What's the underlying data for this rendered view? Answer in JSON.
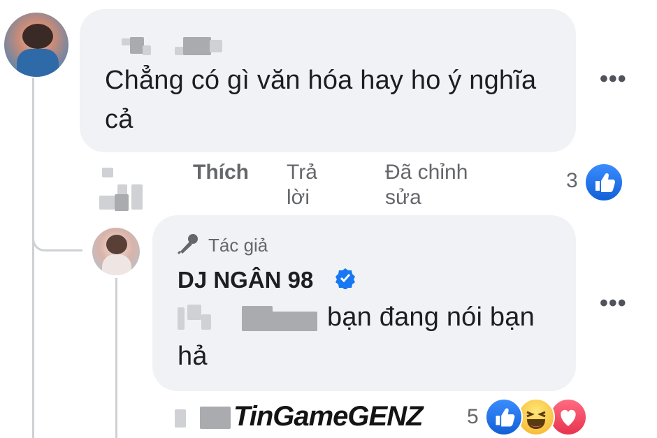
{
  "colors": {
    "bubble": "#f0f2f5",
    "secondary_text": "#65676b",
    "like_blue": "#1877f2",
    "verified_blue": "#1877f2",
    "love_red": "#f33e58",
    "haha_yellow": "#f7b125"
  },
  "comment": {
    "text": "Chẳng có gì văn hóa hay ho ý nghĩa cả",
    "actions": {
      "like": "Thích",
      "reply": "Trả lời",
      "edited": "Đã chỉnh sửa"
    },
    "reaction_count": "3",
    "reactions": [
      "like-icon"
    ]
  },
  "reply": {
    "author_badge": "Tác giả",
    "author_name": "DJ NGÂN 98",
    "verified": true,
    "text_visible": "bạn đang nói bạn hả",
    "reaction_count": "5",
    "reactions": [
      "like-icon",
      "haha-icon",
      "love-icon"
    ]
  },
  "watermark": {
    "text": "TinGameGENZ"
  },
  "icons": {
    "more": "more-options-icon",
    "author": "microphone-icon",
    "verified": "verified-badge-icon"
  }
}
